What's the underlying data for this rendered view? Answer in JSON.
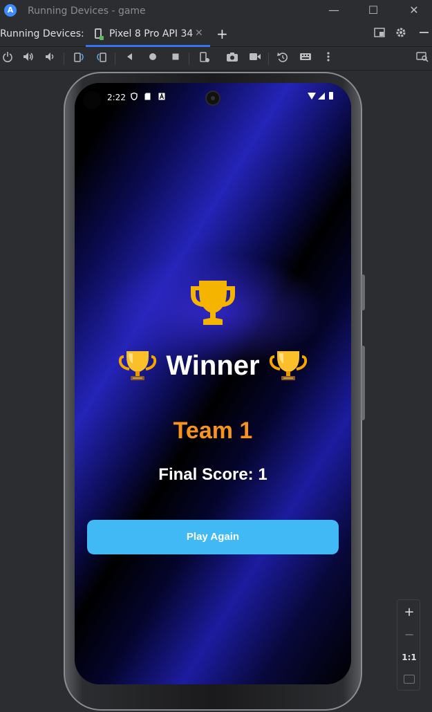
{
  "window": {
    "title": "Running Devices - game",
    "logo_glyph": "A",
    "minimize_glyph": "—",
    "maximize_glyph": "☐",
    "close_glyph": "✕"
  },
  "tabbar": {
    "label": "Running Devices:",
    "tab_label": "Pixel 8 Pro API 34",
    "tab_close_glyph": "✕",
    "add_glyph": "+",
    "icons": [
      "layout-icon",
      "gear-icon",
      "minimize-icon"
    ]
  },
  "toolbar": {
    "icons": [
      "power-icon",
      "volume-up-icon",
      "volume-down-icon",
      "rotate-left-icon",
      "rotate-right-icon",
      "back-icon",
      "home-icon",
      "overview-icon",
      "device-settings-icon",
      "camera-icon",
      "video-icon",
      "reset-icon",
      "keyboard-icon",
      "more-icon",
      "inspect-icon"
    ]
  },
  "device": {
    "status_time": "2:22",
    "status_icons": [
      "shield-icon",
      "sd-card-icon",
      "a-icon",
      "wifi-icon",
      "signal-icon",
      "battery-icon"
    ]
  },
  "game": {
    "winner_label": "Winner",
    "team_name": "Team 1",
    "final_score": "Final Score: 1",
    "play_again_label": "Play Again",
    "trophy_color": "#f5b400",
    "team_color": "#f7941d",
    "button_color": "#40b9f4"
  },
  "zoom": {
    "zoom_in": "+",
    "zoom_out": "−",
    "actual_size": "1:1"
  }
}
